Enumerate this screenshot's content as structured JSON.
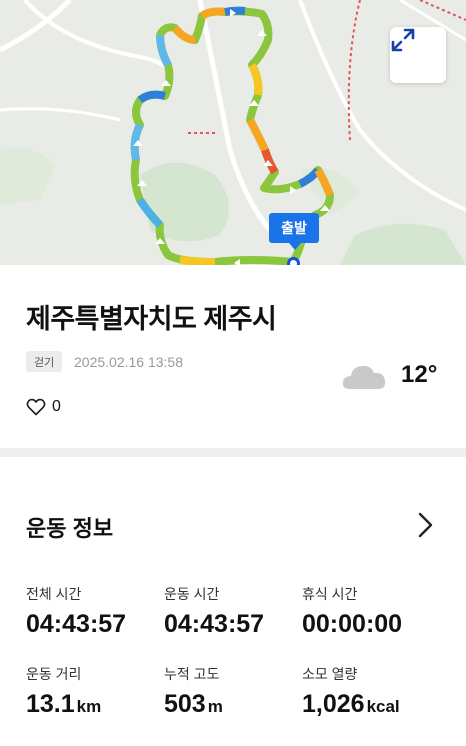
{
  "map": {
    "start_label": "출발",
    "expand_icon": "expand-arrows-icon"
  },
  "activity": {
    "title": "제주특별자치도 제주시",
    "type": "걷기",
    "datetime": "2025.02.16 13:58",
    "weather_icon": "cloud-icon",
    "temperature": "12°",
    "like_icon": "heart-outline-icon",
    "likes": "0"
  },
  "workout": {
    "section_title": "운동 정보",
    "chevron_icon": "chevron-right-icon",
    "stats": [
      {
        "label": "전체 시간",
        "value": "04:43:57",
        "unit": ""
      },
      {
        "label": "운동 시간",
        "value": "04:43:57",
        "unit": ""
      },
      {
        "label": "휴식 시간",
        "value": "00:00:00",
        "unit": ""
      },
      {
        "label": "운동 거리",
        "value": "13.1",
        "unit": "km"
      },
      {
        "label": "누적 고도",
        "value": "503",
        "unit": "m"
      },
      {
        "label": "소모 열량",
        "value": "1,026",
        "unit": "kcal"
      }
    ]
  }
}
